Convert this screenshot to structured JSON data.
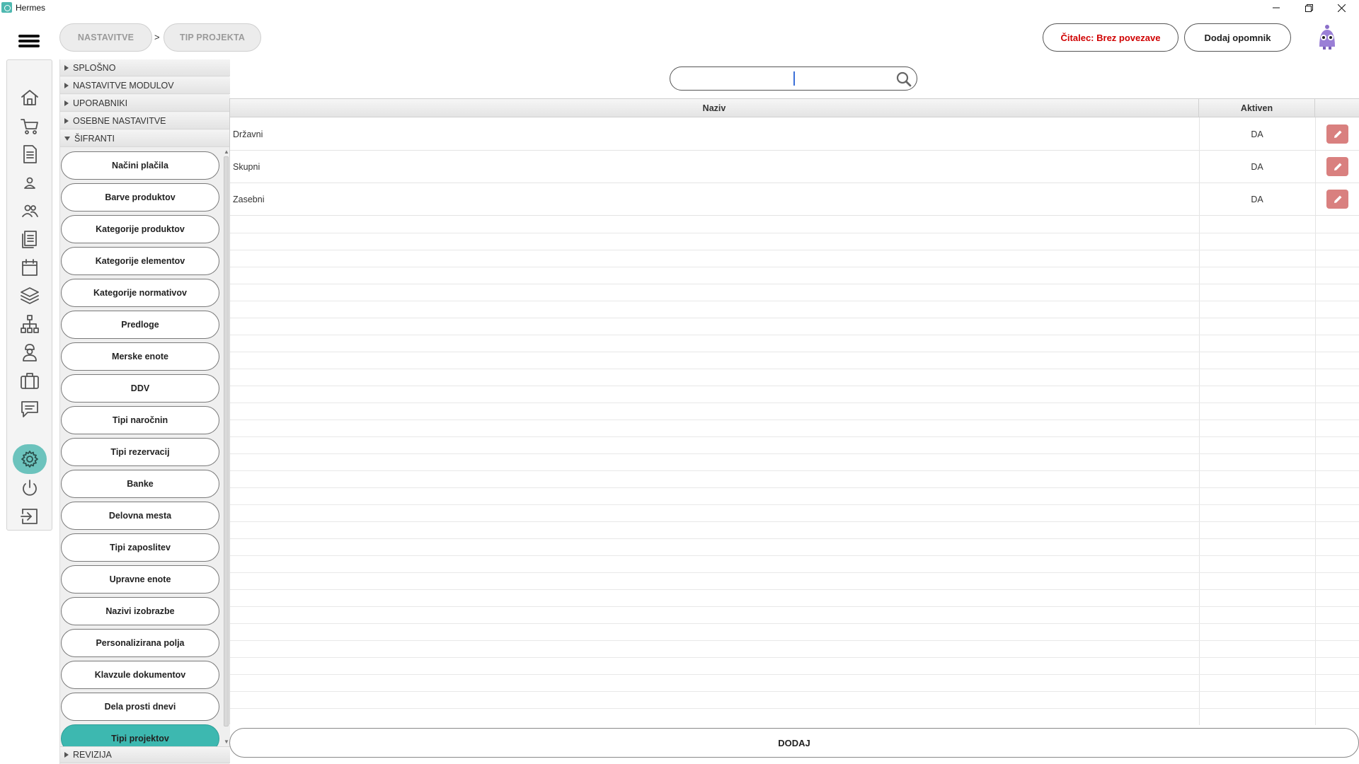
{
  "window": {
    "title": "Hermes"
  },
  "breadcrumb": {
    "items": [
      "NASTAVITVE",
      "TIP PROJEKTA"
    ],
    "separator": ">"
  },
  "header": {
    "reader_status": "Čitalec: Brez povezave",
    "reader_status_color": "#d00000",
    "add_reminder": "Dodaj opomnik"
  },
  "nav_icons": [
    "home-icon",
    "cart-icon",
    "document-icon",
    "person-icon",
    "people-icon",
    "documents-icon",
    "calendar-icon",
    "layers-icon",
    "network-icon",
    "worker-icon",
    "briefcase-icon",
    "chat-icon",
    "settings-icon",
    "power-icon",
    "logout-icon"
  ],
  "tree": {
    "sections": [
      "SPLOŠNO",
      "NASTAVITVE MODULOV",
      "UPORABNIKI",
      "OSEBNE NASTAVITVE",
      "ŠIFRANTI"
    ],
    "footer_section": "REVIZIJA",
    "codebooks": [
      "Načini plačila",
      "Barve produktov",
      "Kategorije produktov",
      "Kategorije elementov",
      "Kategorije normativov",
      "Predloge",
      "Merske enote",
      "DDV",
      "Tipi naročnin",
      "Tipi rezervacij",
      "Banke",
      "Delovna mesta",
      "Tipi zaposlitev",
      "Upravne enote",
      "Nazivi izobrazbe",
      "Personalizirana polja",
      "Klavzule dokumentov",
      "Dela prosti dnevi",
      "Tipi projektov"
    ],
    "active_codebook": "Tipi projektov"
  },
  "search": {
    "value": ""
  },
  "table": {
    "columns": [
      "Naziv",
      "Aktiven"
    ],
    "rows": [
      {
        "naziv": "Državni",
        "aktiven": "DA"
      },
      {
        "naziv": "Skupni",
        "aktiven": "DA"
      },
      {
        "naziv": "Zasebni",
        "aktiven": "DA"
      }
    ]
  },
  "footer": {
    "add_button": "DODAJ"
  },
  "colors": {
    "accent": "#3db8b0",
    "edit": "#d9807f"
  }
}
